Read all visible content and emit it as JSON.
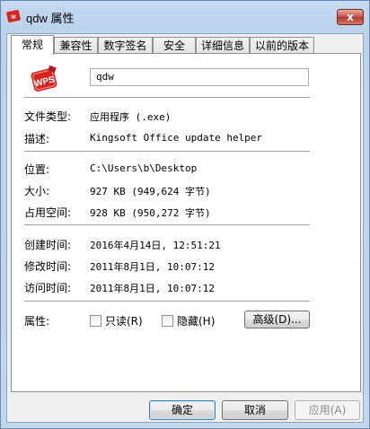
{
  "window": {
    "title": "qdw 属性",
    "close_glyph": "x"
  },
  "tabs": [
    {
      "label": "常规",
      "active": true
    },
    {
      "label": "兼容性"
    },
    {
      "label": "数字签名"
    },
    {
      "label": "安全"
    },
    {
      "label": "详细信息"
    },
    {
      "label": "以前的版本"
    }
  ],
  "file": {
    "name": "qdw",
    "icon": "wps-app-icon"
  },
  "details": {
    "type_label": "文件类型:",
    "type_value": "应用程序 (.exe)",
    "desc_label": "描述:",
    "desc_value": "Kingsoft Office update helper",
    "location_label": "位置:",
    "location_value": "C:\\Users\\b\\Desktop",
    "size_label": "大小:",
    "size_value": "927 KB (949,624 字节)",
    "disk_label": "占用空间:",
    "disk_value": "928 KB (950,272 字节)",
    "created_label": "创建时间:",
    "created_value": "2016年4月14日, 12:51:21",
    "modified_label": "修改时间:",
    "modified_value": "2011年8月1日, 10:07:12",
    "accessed_label": "访问时间:",
    "accessed_value": "2011年8月1日, 10:07:12"
  },
  "attributes": {
    "label": "属性:",
    "readonly_label": "只读(R)",
    "hidden_label": "隐藏(H)",
    "advanced_label": "高级(D)..."
  },
  "footer": {
    "ok_label": "确定",
    "cancel_label": "取消",
    "apply_label": "应用(A)"
  },
  "colors": {
    "wps_red": "#d8241c",
    "close_red": "#c75050"
  }
}
